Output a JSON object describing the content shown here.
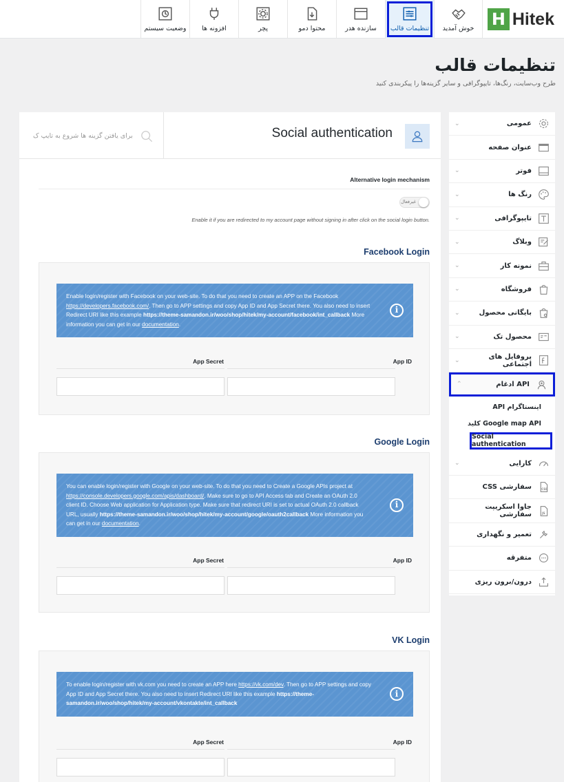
{
  "brand": {
    "letter": "H",
    "name": "Hitek"
  },
  "tabs": [
    {
      "label": "خوش آمدید",
      "icon": "handshake-icon"
    },
    {
      "label": "تنظیمات قالب",
      "icon": "sliders-icon",
      "active": true
    },
    {
      "label": "سازنده هدر",
      "icon": "header-builder-icon"
    },
    {
      "label": "محتوا دمو",
      "icon": "demo-import-icon"
    },
    {
      "label": "پچر",
      "icon": "patcher-gear-icon"
    },
    {
      "label": "افزونه ها",
      "icon": "plugin-icon"
    },
    {
      "label": "وضعیت سیستم",
      "icon": "system-status-icon"
    }
  ],
  "header": {
    "title": "تنظیمات قالب",
    "subtitle": "طرح وب‌سایت، رنگ‌ها، تایپوگرافی و سایر گزینه‌ها را پیکربندی کنید"
  },
  "sidebar": {
    "items": [
      {
        "label": "عمومی",
        "icon": "gear-icon",
        "chevron": true
      },
      {
        "label": "عنوان صفحه",
        "icon": "page-title-icon",
        "chevron": false
      },
      {
        "label": "فوتر",
        "icon": "footer-icon",
        "chevron": true
      },
      {
        "label": "رنگ ها",
        "icon": "palette-icon",
        "chevron": true
      },
      {
        "label": "تایپوگرافی",
        "icon": "typography-icon",
        "chevron": true
      },
      {
        "label": "وبلاگ",
        "icon": "blog-icon",
        "chevron": true
      },
      {
        "label": "نمونه کار",
        "icon": "portfolio-icon",
        "chevron": true
      },
      {
        "label": "فروشگاه",
        "icon": "shop-bag-icon",
        "chevron": true
      },
      {
        "label": "بایگانی محصول",
        "icon": "archive-icon",
        "chevron": true
      },
      {
        "label": "محصول تک",
        "icon": "single-product-icon",
        "chevron": true
      },
      {
        "label": "پروفایل های اجتماعی",
        "icon": "social-icon",
        "chevron": true
      },
      {
        "label": "ادغام API",
        "icon": "api-icon",
        "chevron": true,
        "open": true
      }
    ],
    "subitems": [
      {
        "label": "API اینستاگرام"
      },
      {
        "label": "کلید Google map API"
      },
      {
        "label": "Social authentication",
        "active": true
      }
    ],
    "items_after": [
      {
        "label": "کارایی",
        "icon": "speed-icon",
        "chevron": true
      },
      {
        "label": "CSS سفارشی",
        "icon": "css-file-icon",
        "chevron": false
      },
      {
        "label": "جاوا اسکریپت سفارشی",
        "icon": "js-file-icon",
        "chevron": false
      },
      {
        "label": "تعمیر و نگهداری",
        "icon": "maintenance-icon",
        "chevron": false
      },
      {
        "label": "متفرقه",
        "icon": "misc-icon",
        "chevron": false
      },
      {
        "label": "درون/برون ریزی",
        "icon": "import-export-icon",
        "chevron": false
      }
    ]
  },
  "panel": {
    "title": "Social authentication",
    "search_placeholder": "برای یافتن گزینه ها شروع به تایپ ک",
    "alt_login": {
      "label": "Alternative login mechanism",
      "toggle_text": "غیرفعال",
      "help": "Enable it if you are redirected to my account page without signing in after click on the social login button."
    }
  },
  "sections": [
    {
      "title": "Facebook Login",
      "note_parts": [
        {
          "t": "Enable login/register with Facebook on your web-site. To do that you need to create an APP on the Facebook "
        },
        {
          "t": "https://developers.facebook.com/",
          "u": true
        },
        {
          "t": ". Then go to APP settings and copy App ID and App Secret there. You also need to insert Redirect URI like this example "
        },
        {
          "t": "https://theme-samandon.ir/woo/shop/hitek/my-account/facebook/int_callback",
          "b": true
        },
        {
          "t": " More information you can get in our "
        },
        {
          "t": "documentation",
          "u": true
        },
        {
          "t": "."
        }
      ],
      "app_id_label": "App ID",
      "app_secret_label": "App Secret"
    },
    {
      "title": "Google Login",
      "note_parts": [
        {
          "t": "You can enable login/register with Google on your web-site. To do that you need to Create a Google APIs project at "
        },
        {
          "t": "https://console.developers.google.com/apis/dashboard/",
          "u": true
        },
        {
          "t": ". Make sure to go to API Access tab and Create an OAuth 2.0 client ID. Choose Web application for Application type. Make sure that redirect URI is set to actual OAuth 2.0 callback URL, usually "
        },
        {
          "t": "https://theme-samandon.ir/woo/shop/hitek/my-account/google/oauth2callback",
          "b": true
        },
        {
          "t": " More information you can get in our "
        },
        {
          "t": "documentation",
          "u": true
        },
        {
          "t": "."
        }
      ],
      "app_id_label": "App ID",
      "app_secret_label": "App Secret"
    },
    {
      "title": "VK Login",
      "note_parts": [
        {
          "t": "To enable login/register with vk.com you need to create an APP here "
        },
        {
          "t": "https://vk.com/dev",
          "u": true
        },
        {
          "t": ". Then go to APP settings and copy App ID and App Secret there. You also need to insert Redirect URI like this example "
        },
        {
          "t": "https://theme-samandon.ir/woo/shop/hitek/my-account/vkontakte/int_callback",
          "b": true
        }
      ],
      "app_id_label": "App ID",
      "app_secret_label": "App Secret"
    }
  ],
  "colors": {
    "accent": "#0b5cad",
    "highlight_border": "#0a1ed8",
    "note_bg": "#5b95d1",
    "brand_green": "#4fa447",
    "section_title": "#1c3d6e"
  }
}
